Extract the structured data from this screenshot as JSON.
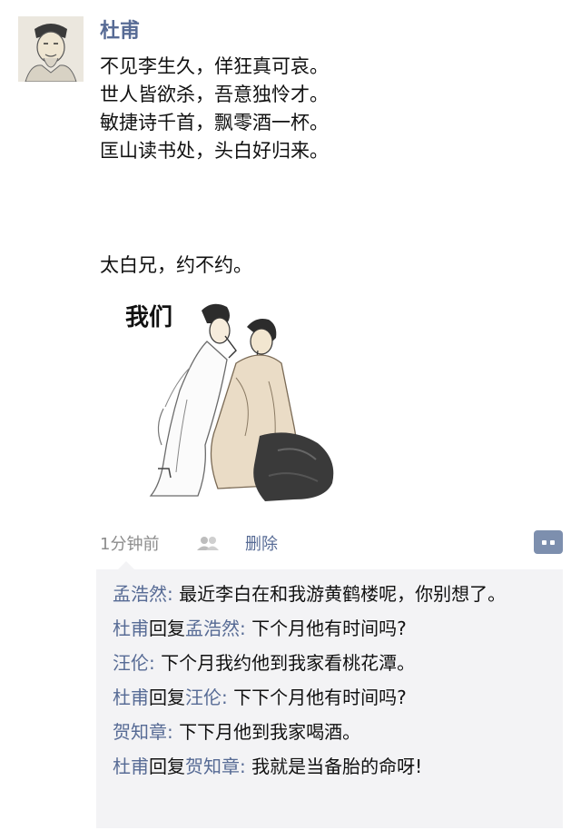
{
  "post": {
    "author": "杜甫",
    "lines": [
      "不见李生久，佯狂真可哀。",
      "世人皆欲杀，吾意独怜才。",
      "敏捷诗千首，飘零酒一杯。",
      "匡山读书处，头白好归来。"
    ],
    "extra": "太白兄，约不约。",
    "image_caption": "我们",
    "time": "1分钟前",
    "delete_label": "删除"
  },
  "comments": [
    {
      "name": "孟浩然",
      "sep": ":",
      "text": "最近李白在和我游黄鹤楼呢，你别想了。"
    },
    {
      "name": "杜甫",
      "reply": "回复",
      "target": "孟浩然",
      "sep": ":",
      "text": "下个月他有时间吗?"
    },
    {
      "name": "汪伦",
      "sep": ":",
      "text": "下个月我约他到我家看桃花潭。"
    },
    {
      "name": "杜甫",
      "reply": "回复",
      "target": "汪伦",
      "sep": ":",
      "text": "下下个月他有时间吗?"
    },
    {
      "name": "贺知章",
      "sep": ":",
      "text": "下下月他到我家喝酒。"
    },
    {
      "name": "杜甫",
      "reply": "回复",
      "target": "贺知章",
      "sep": ":",
      "text": "我就是当备胎的命呀!"
    }
  ],
  "colors": {
    "link": "#576b95",
    "comment_bg": "#f3f3f5",
    "meta": "#8c8c8c"
  },
  "icons": {
    "people": "people-icon",
    "comment": "comment-icon"
  }
}
